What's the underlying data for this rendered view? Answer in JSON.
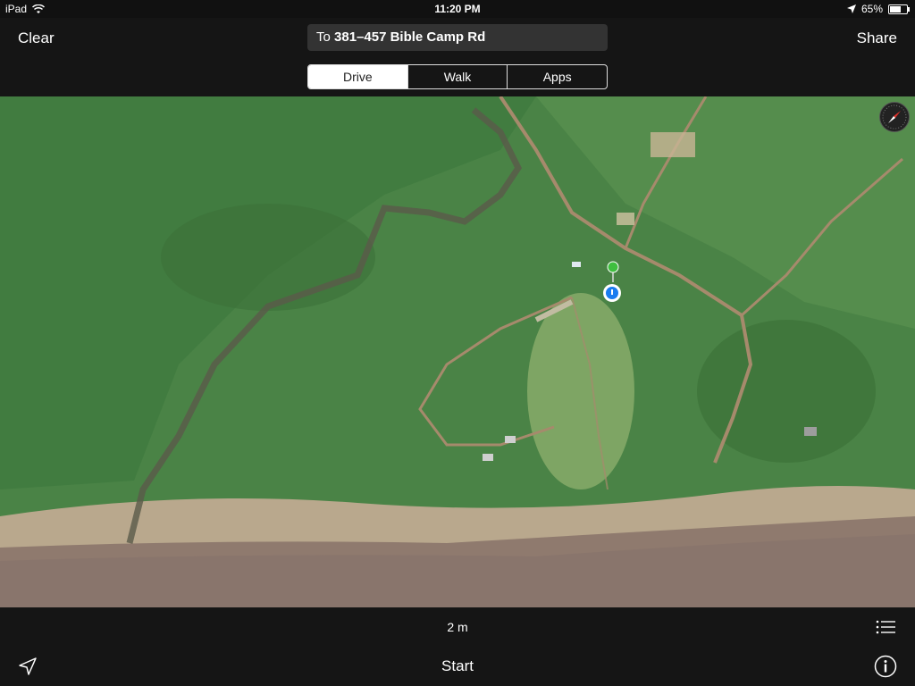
{
  "status": {
    "device": "iPad",
    "time": "11:20 PM",
    "battery": "65%"
  },
  "nav": {
    "clear_label": "Clear",
    "share_label": "Share",
    "destination_prefix": "To",
    "destination_address": "381–457 Bible Camp Rd",
    "modes": [
      "Drive",
      "Walk",
      "Apps"
    ],
    "active_mode": "Drive"
  },
  "map": {
    "compass": "compass-icon"
  },
  "bottom": {
    "distance": "2 m",
    "start_label": "Start"
  },
  "colors": {
    "bar_background": "#151515",
    "route_start": "#3fbf3f",
    "current_location": "#1a7cf0"
  }
}
